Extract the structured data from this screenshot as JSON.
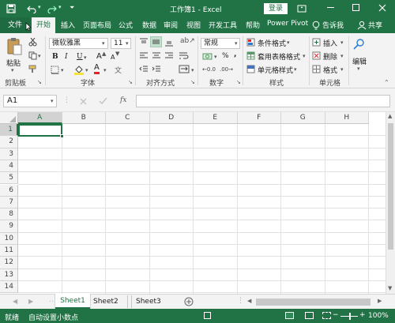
{
  "window": {
    "title": "工作簿1 - Excel",
    "login_label": "登录"
  },
  "ribbon_tabs": [
    {
      "label": "文件",
      "active": false
    },
    {
      "label": "开始",
      "active": true
    },
    {
      "label": "插入",
      "active": false
    },
    {
      "label": "页面布局",
      "active": false
    },
    {
      "label": "公式",
      "active": false
    },
    {
      "label": "数据",
      "active": false
    },
    {
      "label": "审阅",
      "active": false
    },
    {
      "label": "视图",
      "active": false
    },
    {
      "label": "开发工具",
      "active": false
    },
    {
      "label": "帮助",
      "active": false
    },
    {
      "label": "Power Pivot",
      "active": false
    }
  ],
  "tell_me": "告诉我",
  "share": "共享",
  "groups": {
    "clipboard": {
      "label": "剪贴板",
      "paste": "粘贴"
    },
    "font": {
      "label": "字体",
      "font_name": "微软雅黑",
      "font_size": "11",
      "bold": "B",
      "italic": "I",
      "underline": "U",
      "grow": "A",
      "shrink": "A",
      "font_color": "A"
    },
    "alignment": {
      "label": "对齐方式"
    },
    "number": {
      "label": "数字",
      "format": "常规",
      "percent": "%",
      "comma": ","
    },
    "styles": {
      "label": "样式",
      "conditional": "条件格式",
      "table": "套用表格格式",
      "cell_styles": "单元格样式"
    },
    "cells": {
      "label": "单元格",
      "insert": "插入",
      "delete": "删除",
      "format": "格式"
    },
    "editing": {
      "label": "编辑"
    }
  },
  "formula_bar": {
    "name_box": "A1",
    "fx": "fx",
    "value": ""
  },
  "grid": {
    "columns": [
      "A",
      "B",
      "C",
      "D",
      "E",
      "F",
      "G",
      "H"
    ],
    "rows": [
      "1",
      "2",
      "3",
      "4",
      "5",
      "6",
      "7",
      "8",
      "9",
      "10",
      "11",
      "12",
      "13",
      "14"
    ],
    "selected_cell": "A1"
  },
  "sheets": [
    {
      "label": "Sheet1",
      "active": true
    },
    {
      "label": "Sheet2",
      "active": false
    },
    {
      "label": "Sheet3",
      "active": false
    }
  ],
  "status": {
    "mode": "就绪",
    "auto_decimal": "自动设置小数点",
    "zoom": "100%"
  },
  "colors": {
    "accent": "#217346",
    "selection": "#217346"
  }
}
